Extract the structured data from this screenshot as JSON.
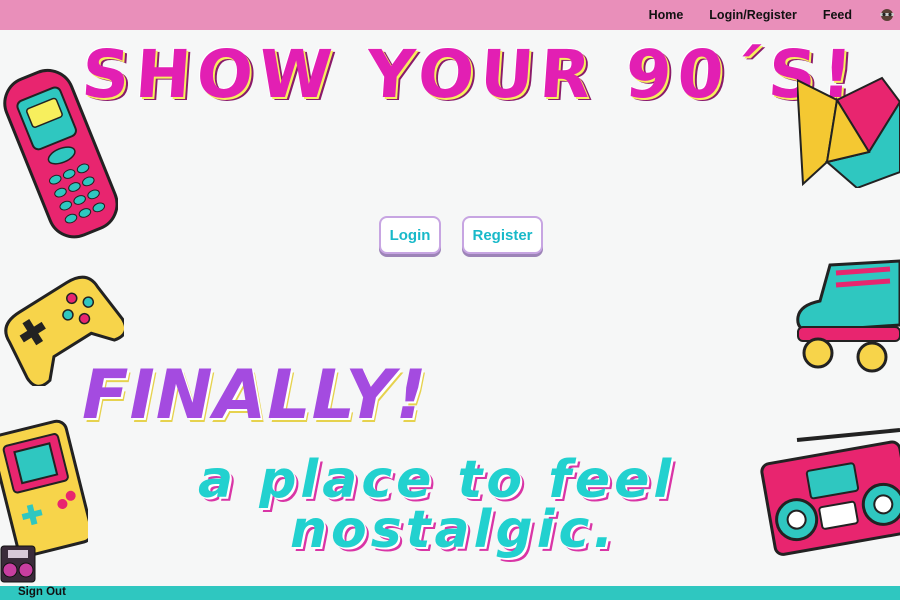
{
  "nav": {
    "items": [
      {
        "label": "Home"
      },
      {
        "label": "Login/Register"
      },
      {
        "label": "Feed"
      }
    ],
    "profile_icon": "profile-avatar-icon"
  },
  "hero": {
    "title": "SHOW YOUR 90´S!",
    "login_label": "Login",
    "register_label": "Register",
    "exclaim": "FINALLY!",
    "tagline_line1": "a place to feel",
    "tagline_line2": "nostalgic."
  },
  "footer": {
    "signout_label": "Sign Out"
  },
  "decorations": [
    "phone-icon",
    "fortune-teller-icon",
    "gamepad-icon",
    "roller-skate-icon",
    "gameboy-icon",
    "boombox-icon"
  ],
  "colors": {
    "topbar": "#e98fba",
    "title": "#e21fb3",
    "accent_cyan": "#22d1cf",
    "purple": "#a44be0",
    "yellow": "#f7ef5d"
  }
}
